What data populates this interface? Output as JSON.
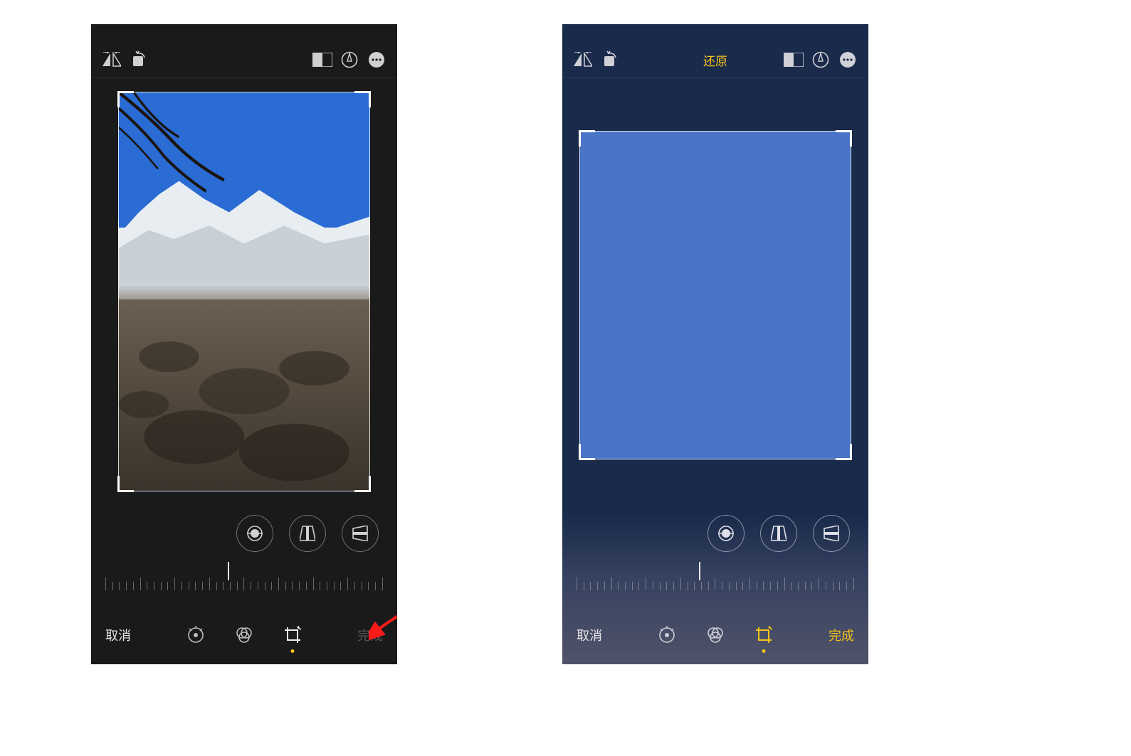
{
  "left": {
    "topbar": {
      "flip_h_icon": "flip-horizontal-icon",
      "rotate_icon": "rotate-icon",
      "aspect_icon": "aspect-ratio-icon",
      "markup_icon": "markup-circle-icon",
      "more_icon": "ellipsis-icon",
      "reset_label": null
    },
    "adjust": {
      "straighten_icon": "straighten-icon",
      "vertical_icon": "perspective-vertical-icon",
      "horizontal_icon": "perspective-horizontal-icon"
    },
    "ruler": {
      "tick_count": 41,
      "indicator_pos_pct": 44
    },
    "modes": {
      "adjust_icon": "adjust-dial-icon",
      "filters_icon": "filters-icon",
      "crop_icon": "crop-rotate-icon",
      "active_index": 2
    },
    "bottom": {
      "cancel_label": "取消",
      "done_label": "完成",
      "done_enabled": false
    },
    "annotation": {
      "arrow_target": "crop-mode-button"
    }
  },
  "right": {
    "topbar": {
      "flip_h_icon": "flip-horizontal-icon",
      "rotate_icon": "rotate-icon",
      "aspect_icon": "aspect-ratio-icon",
      "markup_icon": "markup-circle-icon",
      "more_icon": "ellipsis-icon",
      "reset_label": "还原"
    },
    "adjust": {
      "straighten_icon": "straighten-icon",
      "vertical_icon": "perspective-vertical-icon",
      "horizontal_icon": "perspective-horizontal-icon"
    },
    "ruler": {
      "tick_count": 41,
      "indicator_pos_pct": 44
    },
    "modes": {
      "adjust_icon": "adjust-dial-icon",
      "filters_icon": "filters-icon",
      "crop_icon": "crop-rotate-icon",
      "active_index": 2
    },
    "bottom": {
      "cancel_label": "取消",
      "done_label": "完成",
      "done_enabled": true
    }
  }
}
